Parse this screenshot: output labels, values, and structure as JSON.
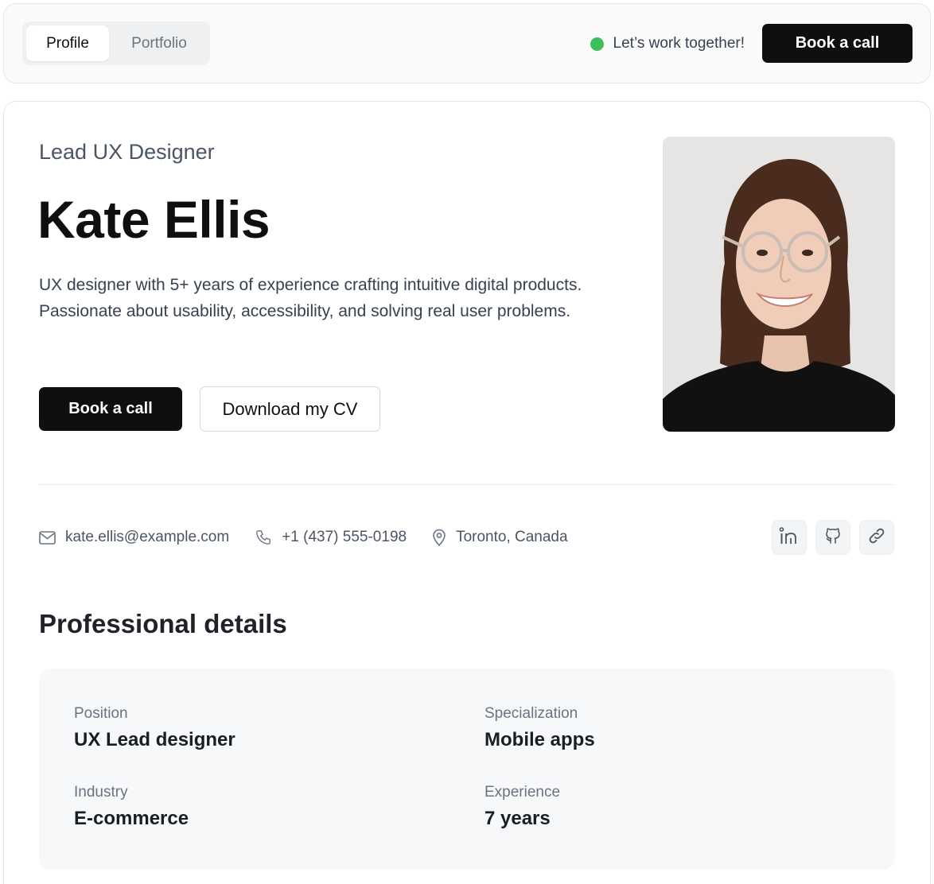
{
  "nav": {
    "tabs": [
      {
        "label": "Profile",
        "active": true
      },
      {
        "label": "Portfolio",
        "active": false
      }
    ],
    "availability_text": "Let’s work together!",
    "availability_color": "#3fbf5a",
    "book_label": "Book a call"
  },
  "hero": {
    "role": "Lead UX Designer",
    "name": "Kate Ellis",
    "bio": "UX designer with 5+ years of experience crafting intuitive digital products. Passionate about usability, accessibility, and solving real user problems.",
    "book_label": "Book a call",
    "cv_label": "Download my CV"
  },
  "contacts": {
    "email": "kate.ellis@example.com",
    "phone": "+1 (437) 555-0198",
    "location": "Toronto, Canada",
    "icons": [
      "mail-icon",
      "phone-icon",
      "map-pin-icon"
    ]
  },
  "socials": [
    "linkedin-icon",
    "github-icon",
    "link-icon"
  ],
  "details": {
    "title": "Professional details",
    "items": [
      {
        "label": "Position",
        "value": "UX Lead designer"
      },
      {
        "label": "Specialization",
        "value": "Mobile apps"
      },
      {
        "label": "Industry",
        "value": "E-commerce"
      },
      {
        "label": "Experience",
        "value": "7 years"
      }
    ]
  }
}
